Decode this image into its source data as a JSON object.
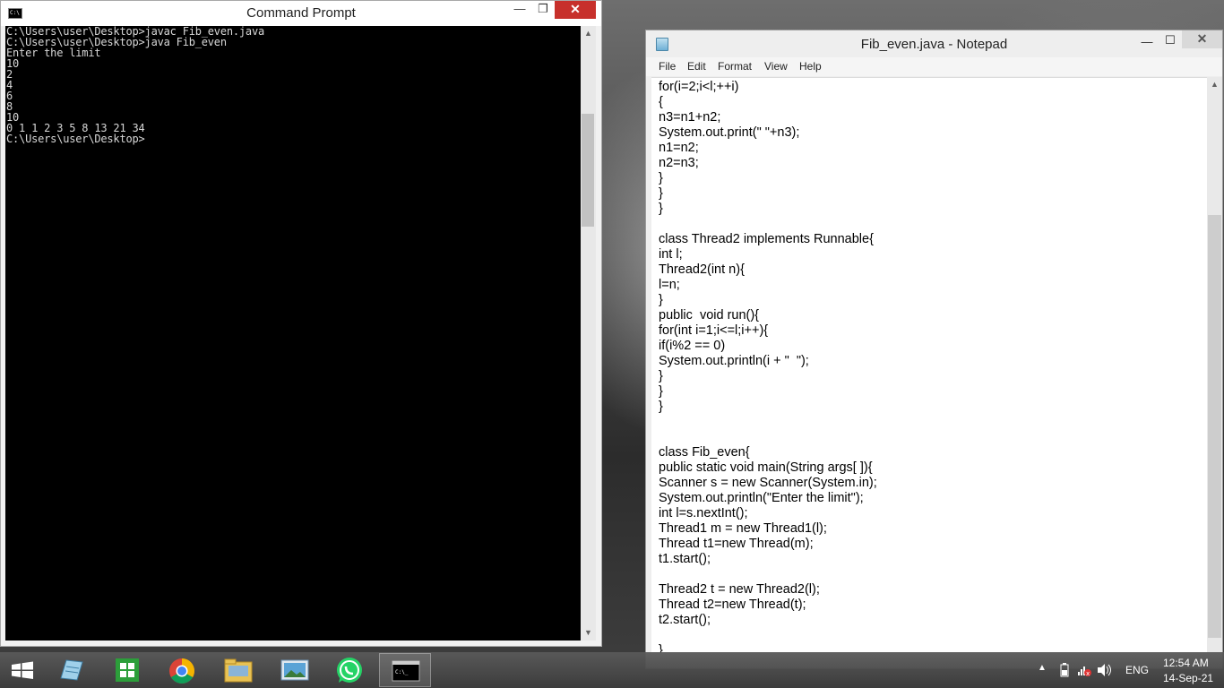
{
  "cmd": {
    "title": "Command Prompt",
    "minimize": "—",
    "maximize": "❐",
    "close": "✕",
    "lines": [
      "C:\\Users\\user\\Desktop>javac Fib_even.java",
      "",
      "C:\\Users\\user\\Desktop>java Fib_even",
      "Enter the limit",
      "10",
      "2",
      "4",
      "6",
      "8",
      "10",
      "0 1 1 2 3 5 8 13 21 34",
      "C:\\Users\\user\\Desktop>"
    ]
  },
  "notepad": {
    "title": "Fib_even.java - Notepad",
    "minimize": "—",
    "maximize": "☐",
    "close": "✕",
    "menu": [
      "File",
      "Edit",
      "Format",
      "View",
      "Help"
    ],
    "lines": [
      "for(i=2;i<l;++i)",
      "{",
      "n3=n1+n2;",
      "System.out.print(\" \"+n3);",
      "n1=n2;",
      "n2=n3;",
      "}",
      "}",
      "}",
      "",
      "class Thread2 implements Runnable{",
      "int l;",
      "Thread2(int n){",
      "l=n;",
      "}",
      "public  void run(){",
      "for(int i=1;i<=l;i++){",
      "if(i%2 == 0)",
      "System.out.println(i + \"  \");",
      "}",
      "}",
      "}",
      "",
      "",
      "class Fib_even{",
      "public static void main(String args[ ]){",
      "Scanner s = new Scanner(System.in);",
      "System.out.println(\"Enter the limit\");",
      "int l=s.nextInt();",
      "Thread1 m = new Thread1(l);",
      "Thread t1=new Thread(m);",
      "t1.start();",
      "",
      "Thread2 t = new Thread2(l);",
      "Thread t2=new Thread(t);",
      "t2.start();",
      "",
      "}",
      "}"
    ]
  },
  "taskbar": {
    "apps": [
      "windows-start",
      "file-explorer",
      "store",
      "chrome",
      "libraries",
      "photos",
      "whatsapp",
      "command-prompt"
    ],
    "language": "ENG",
    "time": "12:54 AM",
    "date": "14-Sep-21",
    "tray_arrow": "▲"
  }
}
